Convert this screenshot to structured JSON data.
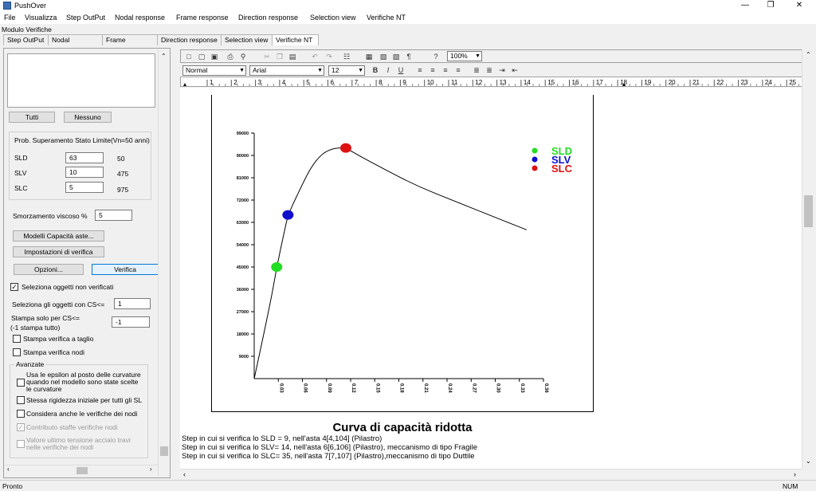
{
  "window": {
    "title": "PushOver"
  },
  "menu": [
    "File",
    "Visualizza",
    "Step OutPut",
    "Nodal response",
    "Frame response",
    "Direction response",
    "Selection view",
    "Verifiche NT"
  ],
  "module_label": "Modulo Verifiche",
  "tabs": [
    "Step OutPut",
    "Nodal response",
    "Frame response",
    "Direction response",
    "Selection view",
    "Verifiche NT"
  ],
  "active_tab": "Verifiche NT",
  "left": {
    "btn_tutti": "Tutti",
    "btn_nessuno": "Nessuno",
    "prob_group_label": "Prob. Superamento Stato Limite(Vn=50 anni)",
    "limit_states": [
      {
        "label": "SLD",
        "value": "63",
        "period": "50"
      },
      {
        "label": "SLV",
        "value": "10",
        "period": "475"
      },
      {
        "label": "SLC",
        "value": "5",
        "period": "975"
      }
    ],
    "smorzamento_label": "Smorzamento viscoso %",
    "smorzamento_value": "5",
    "btn_modelli": "Modelli Capacità aste...",
    "btn_impostazioni": "Impostazioni di verifica",
    "btn_opzioni": "Opzioni...",
    "btn_verifica": "Verifica",
    "seleziona_non_verificati": "Seleziona oggetti non verificati",
    "seleziona_cs_label": "Seleziona gli oggetti con CS<=",
    "seleziona_cs_value": "1",
    "stampa_cs_label1": "Stampa solo per CS<=",
    "stampa_cs_label2": "(-1 stampa tutto)",
    "stampa_cs_value": "-1",
    "stampa_taglio": "Stampa verifica a taglio",
    "stampa_nodi": "Stampa verifica nodi",
    "avanzate_label": "Avanzate",
    "epsilon_label": [
      "Usa le epsilon al posto delle curvature",
      "quando nel modello sono state scelte",
      "le curvature"
    ],
    "stessa_rigidezza": "Stessa rigidezza iniziale per tutti gli SL",
    "considera_nodi": "Considera anche le verifiche dei nodi",
    "contributo_staffe": "Contributo staffe verifiche nodi",
    "valore_ultimo": [
      "Valore ultimo tensione acciaio travi",
      "nelle verifiche dei nodi"
    ]
  },
  "format": {
    "style": "Normal",
    "font": "Arial",
    "size": "12",
    "zoom": "100%"
  },
  "ruler_marks": [
    "1",
    "2",
    "3",
    "4",
    "5",
    "6",
    "7",
    "8",
    "9",
    "10",
    "11",
    "12",
    "13",
    "14",
    "15",
    "16",
    "17",
    "18",
    "19",
    "20",
    "21",
    "22",
    "23",
    "24",
    "25"
  ],
  "chart_data": {
    "type": "line",
    "title": "Curva di capacità ridotta",
    "xlabel": "",
    "ylabel": "",
    "x_ticks": [
      "0.03",
      "0.06",
      "0.09",
      "0.12",
      "0.15",
      "0.18",
      "0.21",
      "0.24",
      "0.27",
      "0.30",
      "0.33",
      "0.36"
    ],
    "y_ticks": [
      "9000",
      "18000",
      "27000",
      "36000",
      "45000",
      "54000",
      "63000",
      "72000",
      "81000",
      "90000",
      "99000"
    ],
    "xlim": [
      0,
      0.36
    ],
    "ylim": [
      0,
      99000
    ],
    "series": [
      {
        "values": [
          [
            0,
            0
          ],
          [
            0.02,
            30000
          ],
          [
            0.028,
            45000
          ],
          [
            0.038,
            60000
          ],
          [
            0.042,
            66000
          ],
          [
            0.055,
            75000
          ],
          [
            0.07,
            85000
          ],
          [
            0.085,
            91000
          ],
          [
            0.1,
            93000
          ],
          [
            0.114,
            93000
          ],
          [
            0.13,
            90000
          ],
          [
            0.15,
            86500
          ],
          [
            0.2,
            78000
          ],
          [
            0.25,
            71500
          ],
          [
            0.3,
            65000
          ],
          [
            0.339,
            60000
          ]
        ]
      }
    ],
    "points": [
      {
        "name": "SLD",
        "x": 0.028,
        "y": 45000,
        "color": "#22dd22"
      },
      {
        "name": "SLV",
        "x": 0.042,
        "y": 66000,
        "color": "#1010cc"
      },
      {
        "name": "SLC",
        "x": 0.114,
        "y": 93000,
        "color": "#dd1111"
      }
    ],
    "legend": [
      "SLD",
      "SLV",
      "SLC"
    ],
    "legend_position": "top-right",
    "grid": false
  },
  "step_lines": [
    "Step in cui si verifica lo SLD = 9, nell'asta 4[4,104] (Pilastro)",
    "Step in cui si verifica lo SLV= 14, nell'asta 6[6,106] (Pilastro), meccanismo di tipo Fragile",
    "Step in cui si verifica lo SLC= 35, nell'asta 7[7,107] (Pilastro),meccanismo di tipo Duttile"
  ],
  "status": {
    "left": "Pronto",
    "right": "NUM"
  }
}
